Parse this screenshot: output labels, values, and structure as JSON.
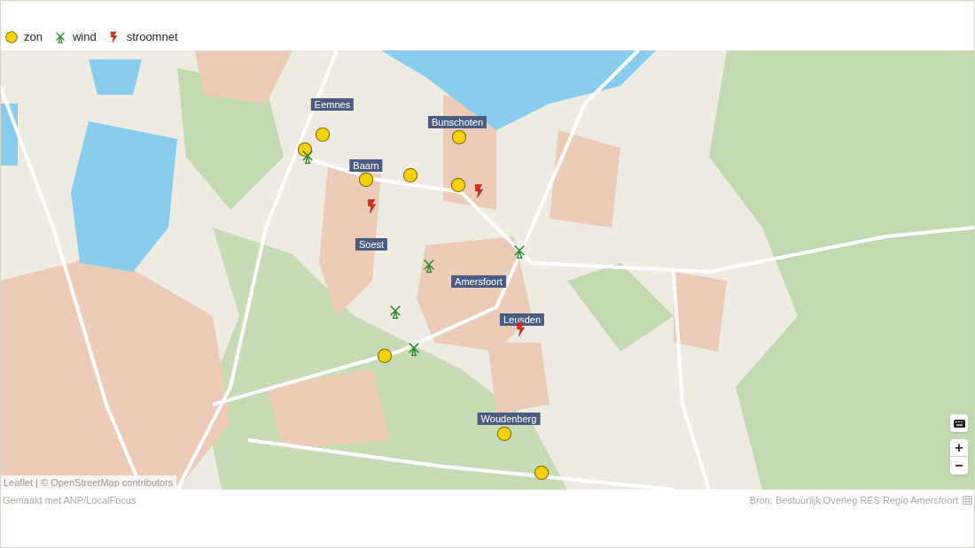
{
  "legend": [
    {
      "kind": "zon",
      "label": "zon"
    },
    {
      "kind": "wind",
      "label": "wind"
    },
    {
      "kind": "stroomnet",
      "label": "stroomnet"
    }
  ],
  "map": {
    "places": [
      "Eemnes",
      "Bunschoten",
      "Baarn",
      "Soest",
      "Amersfoort",
      "Leusden",
      "Woudenberg"
    ],
    "markers": [
      {
        "kind": "zon"
      },
      {
        "kind": "zon"
      },
      {
        "kind": "zon"
      },
      {
        "kind": "zon"
      },
      {
        "kind": "zon"
      },
      {
        "kind": "zon"
      },
      {
        "kind": "zon"
      },
      {
        "kind": "zon"
      },
      {
        "kind": "zon"
      },
      {
        "kind": "wind"
      },
      {
        "kind": "wind"
      },
      {
        "kind": "wind"
      },
      {
        "kind": "wind"
      },
      {
        "kind": "wind"
      },
      {
        "kind": "stroomnet"
      },
      {
        "kind": "stroomnet"
      },
      {
        "kind": "stroomnet"
      }
    ],
    "attribution": "Leaflet | © OpenStreetMap contributors",
    "zoom_in": "+",
    "zoom_out": "−"
  },
  "footer": {
    "credit": "Gemaakt met ANP/LocalFocus",
    "source": "Bron: Bestuurlijk Overleg RES Regio Amersfoort"
  }
}
